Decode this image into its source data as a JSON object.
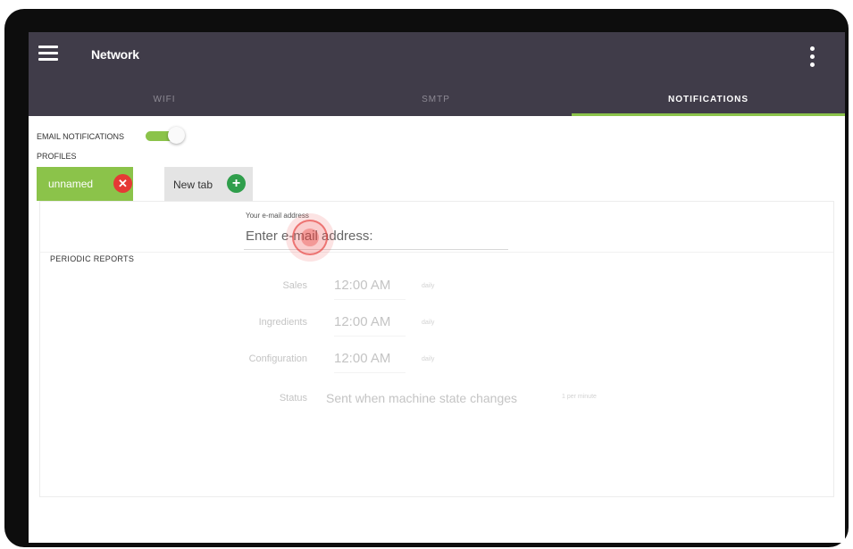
{
  "app": {
    "title": "Network"
  },
  "tabs": [
    {
      "label": "WIFI"
    },
    {
      "label": "SMTP"
    },
    {
      "label": "NOTIFICATIONS"
    }
  ],
  "active_tab": "NOTIFICATIONS",
  "colors": {
    "appbar": "#403c49",
    "accent": "#8bc34a",
    "remove": "#e53935",
    "add": "#2f9e4b"
  },
  "email_notifications": {
    "label": "EMAIL NOTIFICATIONS",
    "enabled": true
  },
  "profiles": {
    "label": "PROFILES",
    "items": [
      {
        "name": "unnamed"
      }
    ],
    "new_tab_label": "New tab"
  },
  "email_field": {
    "label": "Your e-mail address",
    "placeholder": "Enter e-mail address:",
    "value": ""
  },
  "periodic_reports": {
    "title": "PERIODIC REPORTS",
    "rows": [
      {
        "label": "Sales",
        "time": "12:00 AM",
        "frequency": "daily"
      },
      {
        "label": "Ingredients",
        "time": "12:00 AM",
        "frequency": "daily"
      },
      {
        "label": "Configuration",
        "time": "12:00 AM",
        "frequency": "daily"
      }
    ],
    "status": {
      "label": "Status",
      "text": "Sent when machine state changes",
      "frequency": "1 per minute"
    }
  },
  "icons": {
    "menu": "hamburger-menu-icon",
    "more": "more-vertical-icon",
    "remove": "close-icon",
    "add": "plus-icon"
  }
}
